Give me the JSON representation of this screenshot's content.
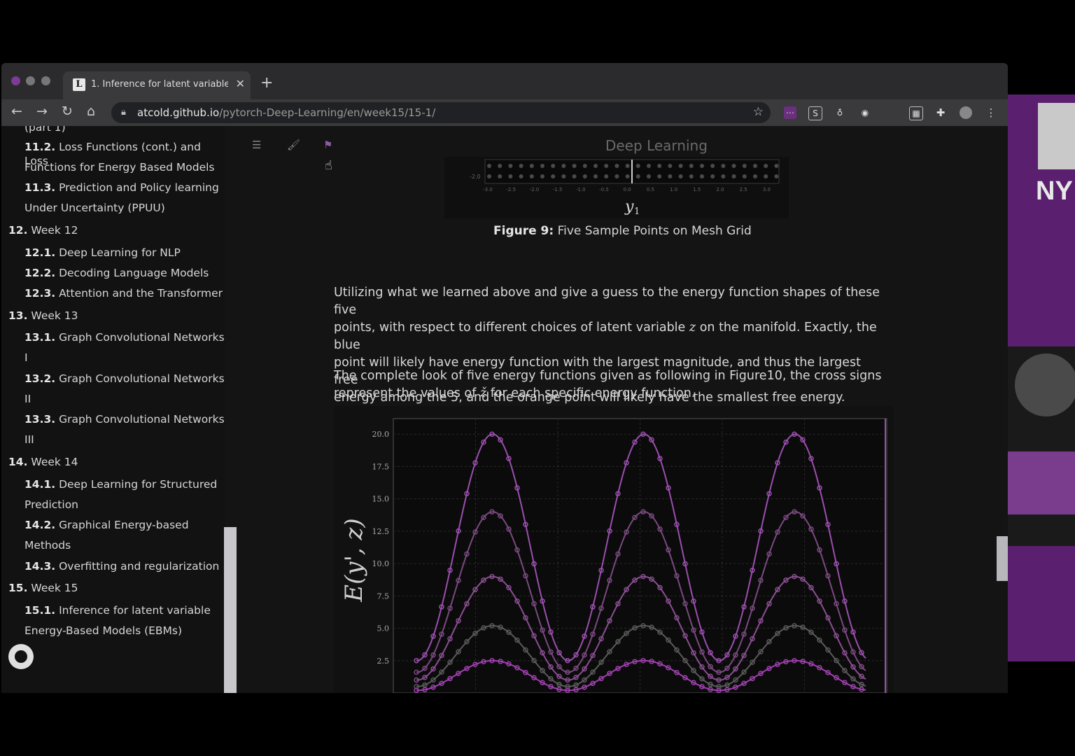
{
  "browser": {
    "tab_title": "1. Inference for latent variable",
    "tab_favicon": "L",
    "url_host": "atcold.github.io",
    "url_path": "/pytorch-Deep-Learning/en/week15/15-1/"
  },
  "sidebar": {
    "items": [
      {
        "level": 2,
        "num": "",
        "text": "(part 1)"
      },
      {
        "level": 2,
        "num": "11.2.",
        "text": "Loss Functions (cont.) and Loss"
      },
      {
        "level": 2,
        "num": "",
        "text": "Functions for Energy Based Models"
      },
      {
        "level": 2,
        "num": "11.3.",
        "text": "Prediction and Policy learning"
      },
      {
        "level": 2,
        "num": "",
        "text": "Under Uncertainty (PPUU)"
      },
      {
        "level": 1,
        "num": "12.",
        "text": "Week 12"
      },
      {
        "level": 2,
        "num": "12.1.",
        "text": "Deep Learning for NLP"
      },
      {
        "level": 2,
        "num": "12.2.",
        "text": "Decoding Language Models"
      },
      {
        "level": 2,
        "num": "12.3.",
        "text": "Attention and the Transformer"
      },
      {
        "level": 1,
        "num": "13.",
        "text": "Week 13"
      },
      {
        "level": 2,
        "num": "13.1.",
        "text": "Graph Convolutional Networks"
      },
      {
        "level": 2,
        "num": "",
        "text": "I"
      },
      {
        "level": 2,
        "num": "13.2.",
        "text": "Graph Convolutional Networks"
      },
      {
        "level": 2,
        "num": "",
        "text": "II"
      },
      {
        "level": 2,
        "num": "13.3.",
        "text": "Graph Convolutional Networks"
      },
      {
        "level": 2,
        "num": "",
        "text": "III"
      },
      {
        "level": 1,
        "num": "14.",
        "text": "Week 14"
      },
      {
        "level": 2,
        "num": "14.1.",
        "text": "Deep Learning for Structured"
      },
      {
        "level": 2,
        "num": "",
        "text": "Prediction"
      },
      {
        "level": 2,
        "num": "14.2.",
        "text": "Graphical Energy-based"
      },
      {
        "level": 2,
        "num": "",
        "text": "Methods"
      },
      {
        "level": 2,
        "num": "14.3.",
        "text": "Overfitting and regularization"
      },
      {
        "level": 1,
        "num": "15.",
        "text": "Week 15"
      },
      {
        "level": 2,
        "num": "15.1.",
        "text": "Inference for latent variable"
      },
      {
        "level": 2,
        "num": "",
        "text": "Energy-Based Models (EBMs)"
      }
    ]
  },
  "book_title": "Deep Learning",
  "figure9": {
    "caption_label": "Figure 9:",
    "caption_text": "Five Sample Points on Mesh Grid",
    "y_tick": "-2.0",
    "x_ticks": [
      "-3.0",
      "-2.5",
      "-2.0",
      "-1.5",
      "-1.0",
      "-0.5",
      "0.0",
      "0.5",
      "1.0",
      "1.5",
      "2.0",
      "2.5",
      "3.0"
    ],
    "xlabel": "y",
    "xlabel_sub": "1"
  },
  "paragraphs": {
    "p1_lines": [
      "Utilizing what we learned above and give a guess to the energy function shapes of these five",
      "points, with respect to different choices of latent variable",
      "on the manifold. Exactly, the blue",
      "point will likely have energy function with the largest magnitude, and thus the largest free",
      "energy among the 5, and the orange point will likely have the smallest free energy."
    ],
    "p1_var": "z",
    "p2_a": "The complete look of five energy functions given as following in Figure10, the cross signs",
    "p2_b": "represent the values of",
    "p2_var": "ž",
    "p2_c": "for each specific energy function."
  },
  "chart_data": {
    "type": "line",
    "title": "",
    "xlabel": "",
    "ylabel": "E(y', z)",
    "yticks": [
      "20.0",
      "17.5",
      "15.0",
      "12.5",
      "10.0",
      "7.5",
      "5.0",
      "2.5"
    ],
    "ylim": [
      0,
      21.2
    ],
    "grid": true,
    "series": [
      {
        "amplitude": 20.0,
        "values": [
          2.5,
          20.0,
          2.5,
          20.0,
          2.5,
          20.0,
          2.5
        ]
      },
      {
        "amplitude": 14.0,
        "values": [
          1.6,
          14.0,
          1.6,
          14.0,
          1.6,
          14.0,
          1.6
        ]
      },
      {
        "amplitude": 9.0,
        "values": [
          1.0,
          9.0,
          1.0,
          9.0,
          1.0,
          9.0,
          1.0
        ]
      },
      {
        "amplitude": 5.2,
        "values": [
          0.5,
          5.2,
          0.5,
          5.2,
          0.5,
          5.2,
          0.5
        ]
      },
      {
        "amplitude": 2.5,
        "values": [
          0.2,
          2.5,
          0.2,
          2.5,
          0.2,
          2.5,
          0.2
        ]
      }
    ],
    "colors": [
      "#9b4fae",
      "#7a4a80",
      "#8a4f92",
      "#5a5a5a",
      "#a040b0"
    ]
  },
  "nyu": {
    "label": "NY"
  },
  "icons": {
    "back": "arrow-left-icon",
    "forward": "arrow-right-icon",
    "reload": "reload-icon",
    "home": "home-icon",
    "lock": "lock-icon",
    "star": "star-icon",
    "menu": "hamburger-icon",
    "theme": "brush-icon",
    "lang": "flag-icon",
    "github": "github-icon"
  }
}
